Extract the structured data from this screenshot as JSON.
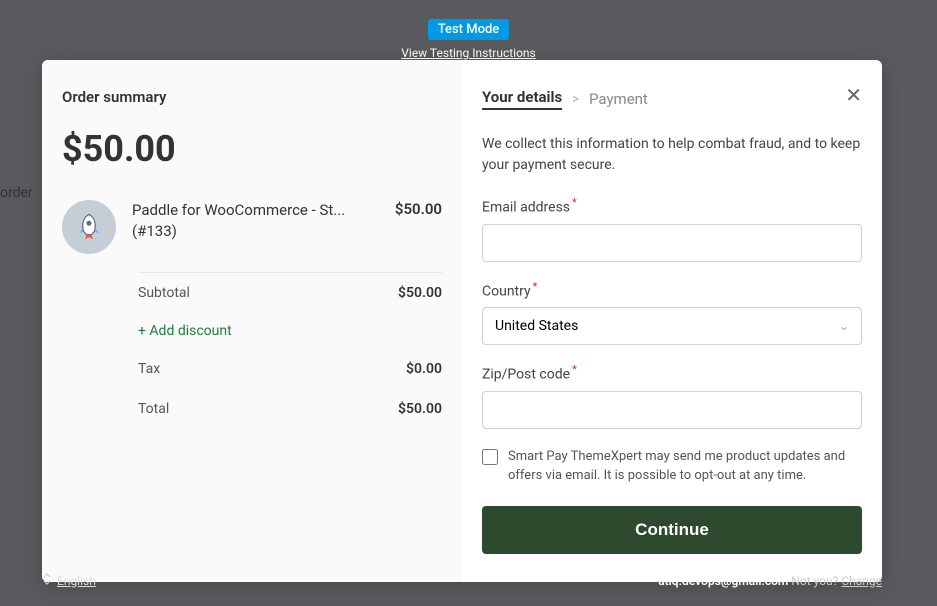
{
  "topBanner": {
    "testMode": "Test Mode",
    "instructionsLink": "View Testing Instructions"
  },
  "bgText": "order",
  "leftPanel": {
    "title": "Order summary",
    "bigPrice": "$50.00",
    "product": {
      "name": "Paddle for WooCommerce - St... (#133)",
      "price": "$50.00"
    },
    "lines": {
      "subtotalLabel": "Subtotal",
      "subtotalValue": "$50.00",
      "addDiscount": "+ Add discount",
      "taxLabel": "Tax",
      "taxValue": "$0.00",
      "totalLabel": "Total",
      "totalValue": "$50.00"
    }
  },
  "rightPanel": {
    "breadcrumb": {
      "current": "Your details",
      "next": "Payment"
    },
    "infoText": "We collect this information to help combat fraud, and to keep your payment secure.",
    "fields": {
      "emailLabel": "Email address",
      "countryLabel": "Country",
      "countryValue": "United States",
      "zipLabel": "Zip/Post code"
    },
    "checkbox": {
      "label": "Smart Pay ThemeXpert may send me product updates and offers via email. It is possible to opt-out at any time."
    },
    "continueButton": "Continue"
  },
  "footer": {
    "language": "English",
    "email": "atiq.devops@gmail.com",
    "notYou": " Not you? ",
    "change": "Change"
  }
}
